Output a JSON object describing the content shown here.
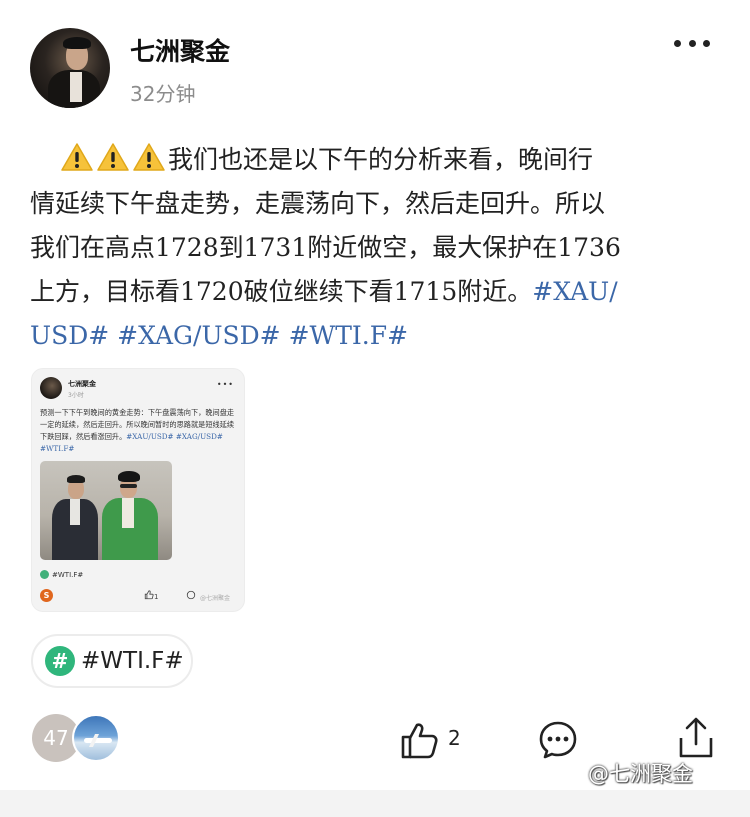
{
  "post": {
    "author": "七洲聚金",
    "time": "32分钟",
    "text_lines": [
      "我们也还是以下午的分析来看，晚间行",
      "情延续下午盘走势，走震荡向下，然后走回升。所以",
      "我们在高点1728到1731附近做空，最大保护在1736",
      "上方，目标看1720破位继续下看1715附近。"
    ],
    "hashtags_inline": [
      "#XAU/",
      "USD#",
      "#XAG/USD#",
      "#WTI.F#"
    ],
    "warning_icon_count": 3
  },
  "embedded_post": {
    "author": "七洲聚金",
    "time": "3小时",
    "text": "预测一下下午到晚间的黄金走势：下午盘震荡向下，晚间盘走一定的延续，然后走回升。所以晚间暂时的思路就是短线延续下跌回踩，然后看涨回升。",
    "hashtags": "#XAU/USD# #XAG/USD# #WTI.F#",
    "topic": "#WTI.F#",
    "like_count": "1",
    "watermark": "@七洲聚金"
  },
  "topic_chip": {
    "icon": "#",
    "label": "#WTI.F#"
  },
  "footer": {
    "likers_count": "47",
    "like_count": "2",
    "watermark": "@七洲聚金"
  }
}
